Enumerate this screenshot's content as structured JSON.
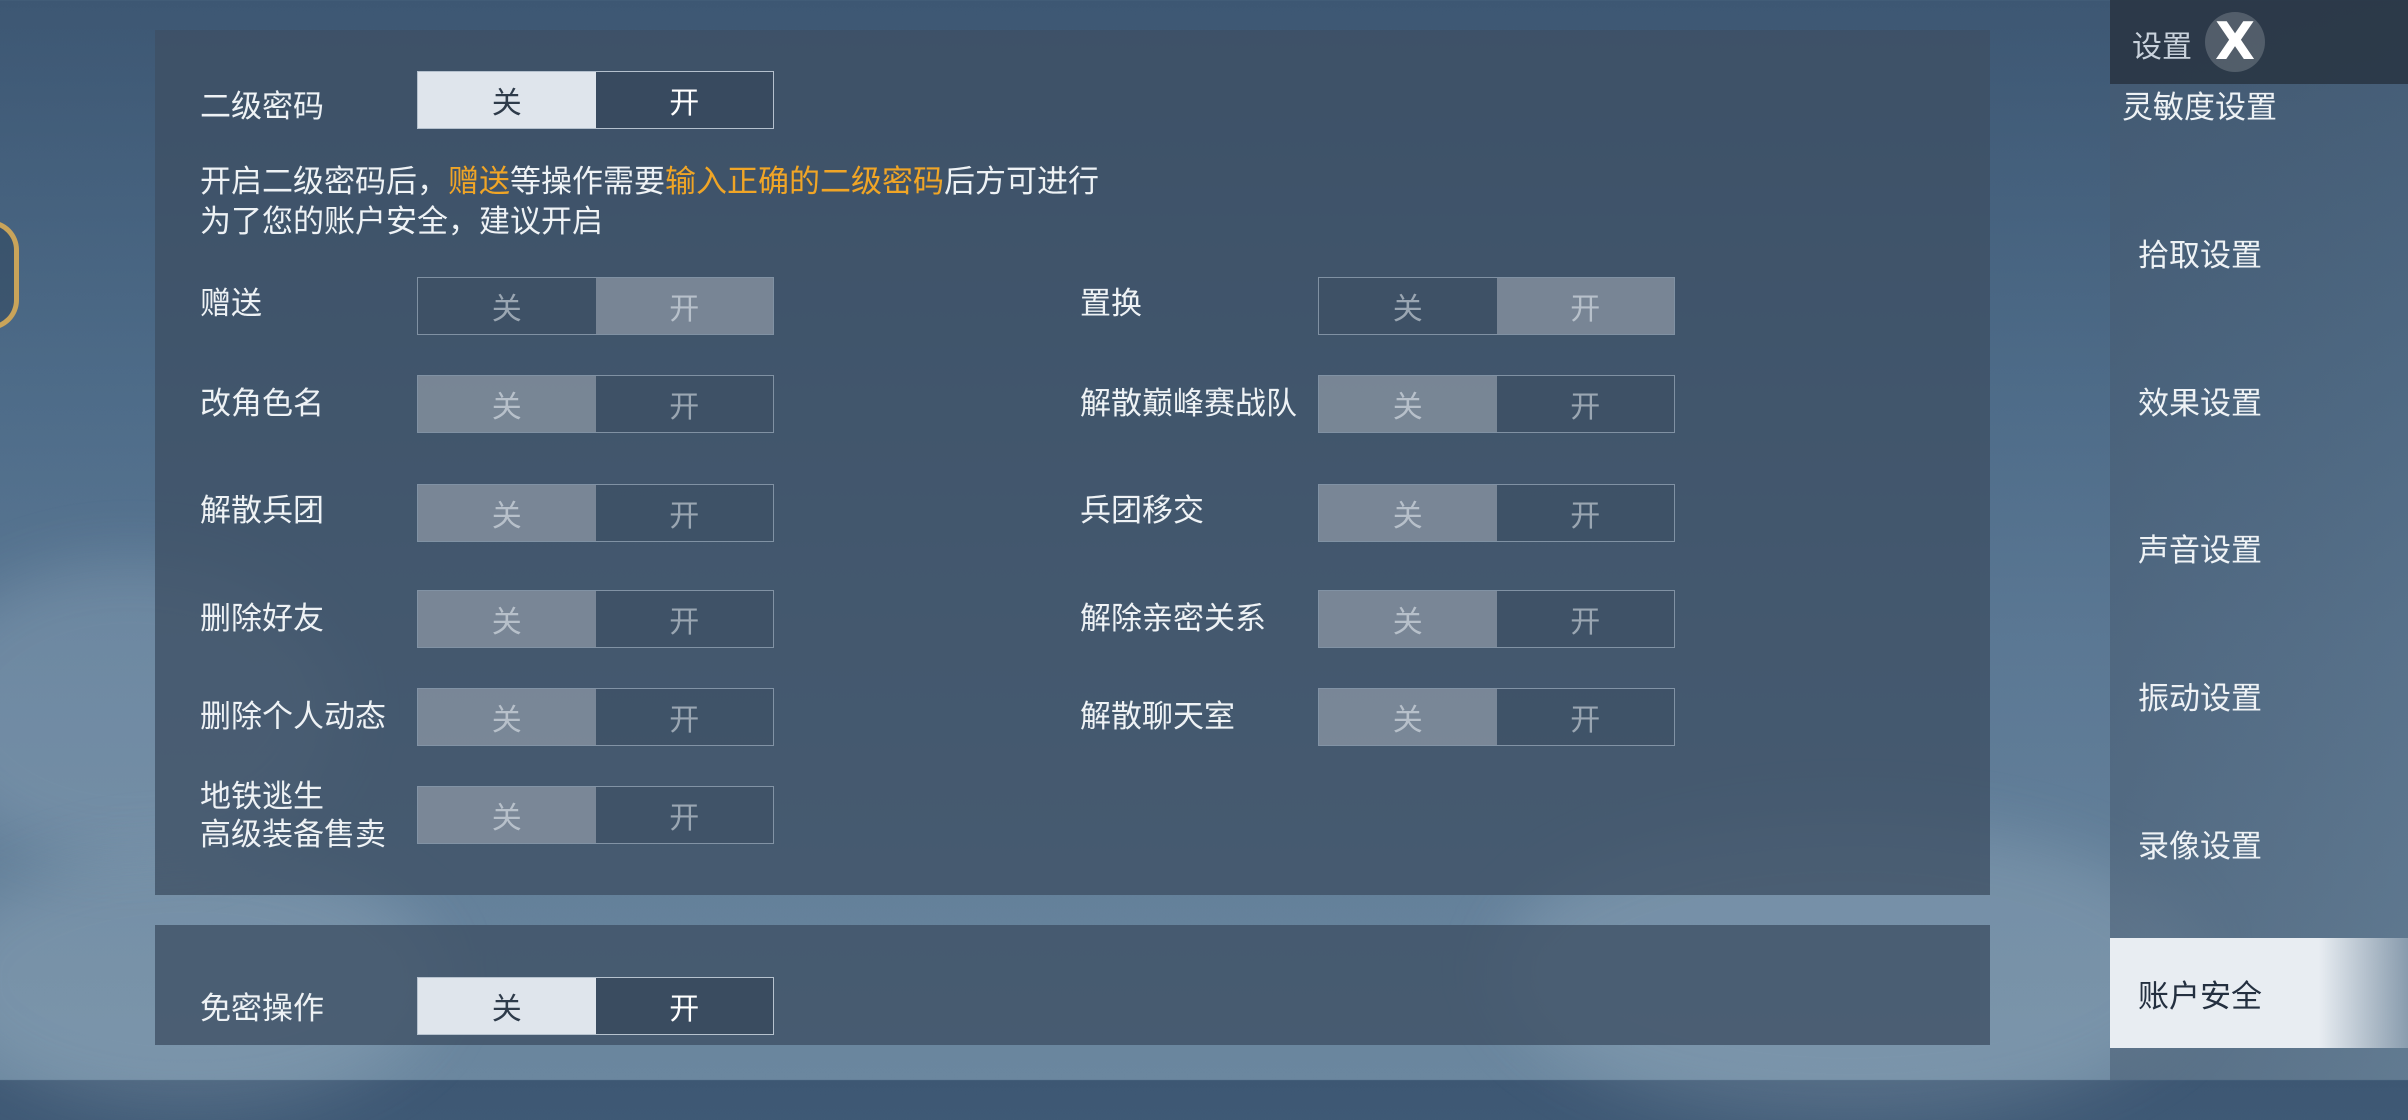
{
  "sidebar": {
    "title": "设置",
    "close_glyph": "X",
    "items": [
      {
        "label": "灵敏度设置"
      },
      {
        "label": "拾取设置"
      },
      {
        "label": "效果设置"
      },
      {
        "label": "声音设置"
      },
      {
        "label": "振动设置"
      },
      {
        "label": "录像设置"
      },
      {
        "label": "账户安全",
        "active": true
      }
    ]
  },
  "secondary_password": {
    "label": "二级密码",
    "off": "关",
    "on": "开",
    "state": "off",
    "desc_line1_a": "开启二级密码后，",
    "desc_line1_hl1": "赠送",
    "desc_line1_b": "等操作需要",
    "desc_line1_hl2": "输入正确的二级密码",
    "desc_line1_c": "后方可进行",
    "desc_line2": "为了您的账户安全，建议开启"
  },
  "options": [
    {
      "label": "赠送",
      "state": "on"
    },
    {
      "label": "置换",
      "state": "on"
    },
    {
      "label": "改角色名",
      "state": "off"
    },
    {
      "label": "解散巅峰赛战队",
      "state": "off"
    },
    {
      "label": "解散兵团",
      "state": "off"
    },
    {
      "label": "兵团移交",
      "state": "off"
    },
    {
      "label": "删除好友",
      "state": "off"
    },
    {
      "label": "解除亲密关系",
      "state": "off"
    },
    {
      "label": "删除个人动态",
      "state": "off"
    },
    {
      "label": "解散聊天室",
      "state": "off"
    },
    {
      "label_line1": "地铁逃生",
      "label_line2": "高级装备售卖",
      "state": "off"
    }
  ],
  "toggle_text": {
    "off": "关",
    "on": "开"
  },
  "no_password": {
    "label": "免密操作",
    "off": "关",
    "on": "开",
    "state": "off"
  },
  "colors": {
    "highlight": "#f0a526"
  }
}
